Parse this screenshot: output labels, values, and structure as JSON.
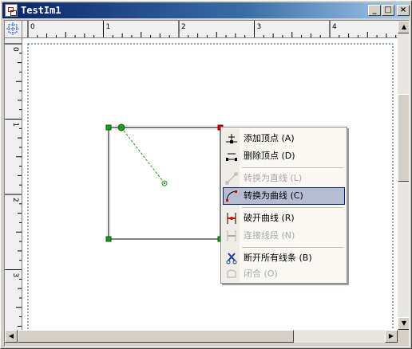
{
  "window": {
    "title": "TestIm1",
    "buttons": {
      "minimize": "_",
      "maximize": "□",
      "close": "×"
    }
  },
  "rulers": {
    "horizontal_labels": [
      "0",
      "1",
      "2",
      "3",
      "4"
    ],
    "vertical_labels": [
      "0",
      "1",
      "2",
      "3"
    ]
  },
  "context_menu": {
    "items": [
      {
        "label": "添加顶点 (A)",
        "icon": "add-vertex-icon",
        "enabled": true,
        "selected": false
      },
      {
        "label": "删除顶点 (D)",
        "icon": "delete-vertex-icon",
        "enabled": true,
        "selected": false
      },
      {
        "label": "转换为直线 (L)",
        "icon": "to-line-icon",
        "enabled": false,
        "selected": false
      },
      {
        "label": "转换为曲线 (C)",
        "icon": "to-curve-icon",
        "enabled": true,
        "selected": true
      },
      {
        "label": "破开曲线 (R)",
        "icon": "break-curve-icon",
        "enabled": true,
        "selected": false
      },
      {
        "label": "连接线段 (N)",
        "icon": "join-segments-icon",
        "enabled": false,
        "selected": false
      },
      {
        "label": "断开所有线条 (B)",
        "icon": "cut-all-icon",
        "enabled": true,
        "selected": false
      },
      {
        "label": "闭合 (O)",
        "icon": "close-path-icon",
        "enabled": false,
        "selected": false
      }
    ]
  },
  "colors": {
    "title_gradient_start": "#0a246a",
    "selection_fill": "#b6bdd2",
    "handle_green": "#1e9a1e",
    "vertex_red": "#dd0000"
  }
}
